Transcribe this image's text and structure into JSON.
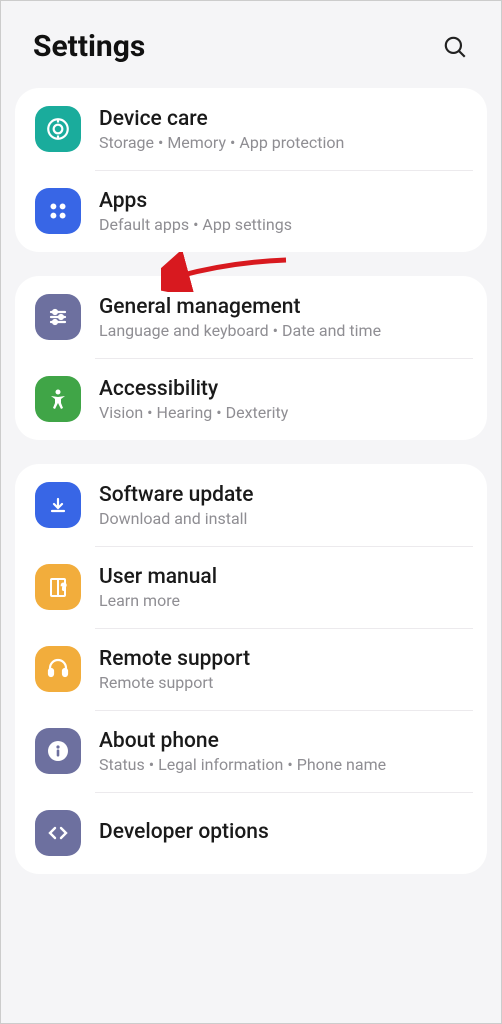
{
  "header": {
    "title": "Settings"
  },
  "groups": [
    {
      "items": [
        {
          "iconColor": "#1aac9c",
          "icon": "device-care",
          "title": "Device care",
          "subtitle": "Storage  •  Memory  •  App protection"
        },
        {
          "iconColor": "#3866e6",
          "icon": "apps",
          "title": "Apps",
          "subtitle": "Default apps  •  App settings"
        }
      ]
    },
    {
      "items": [
        {
          "iconColor": "#6d709f",
          "icon": "sliders",
          "title": "General management",
          "subtitle": "Language and keyboard  •  Date and time"
        },
        {
          "iconColor": "#40a547",
          "icon": "accessibility",
          "title": "Accessibility",
          "subtitle": "Vision  •  Hearing  •  Dexterity"
        }
      ]
    },
    {
      "items": [
        {
          "iconColor": "#3866e6",
          "icon": "update",
          "title": "Software update",
          "subtitle": "Download and install"
        },
        {
          "iconColor": "#f2ad3c",
          "icon": "manual",
          "title": "User manual",
          "subtitle": "Learn more"
        },
        {
          "iconColor": "#f2ad3c",
          "icon": "support",
          "title": "Remote support",
          "subtitle": "Remote support"
        },
        {
          "iconColor": "#6d709f",
          "icon": "about",
          "title": "About phone",
          "subtitle": "Status  •  Legal information  •  Phone name"
        },
        {
          "iconColor": "#6d709f",
          "icon": "developer",
          "title": "Developer options",
          "subtitle": ""
        }
      ]
    }
  ]
}
